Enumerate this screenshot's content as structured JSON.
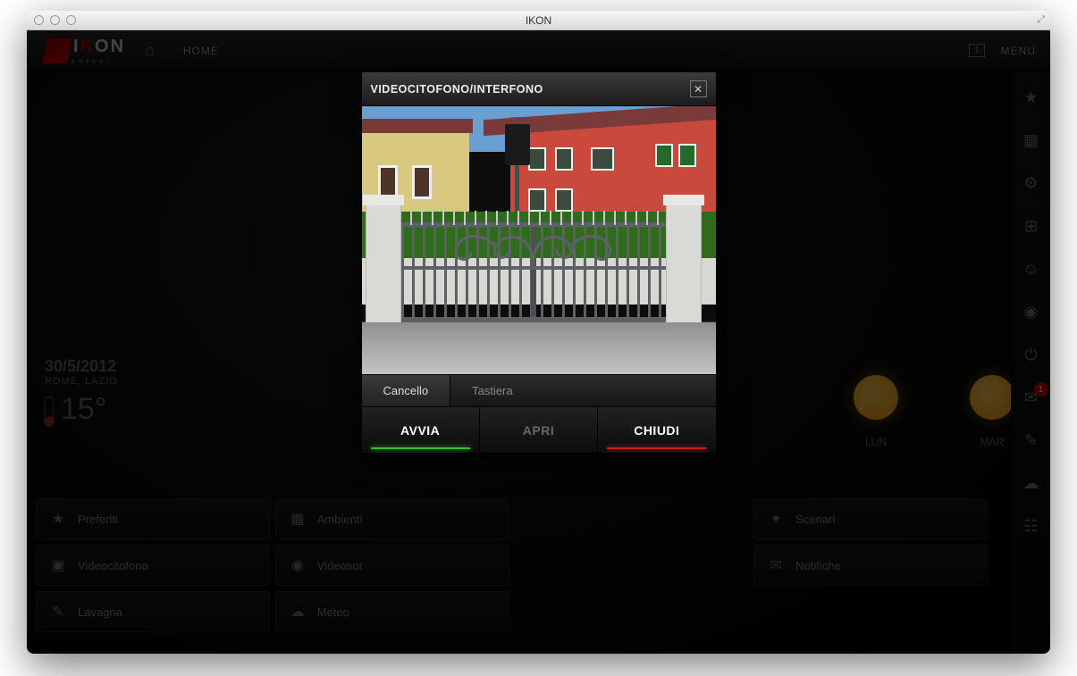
{
  "window": {
    "title": "IKON"
  },
  "logo": {
    "brand_a": "I",
    "brand_b": "ON",
    "sub": "server"
  },
  "topbar": {
    "home_tab": "HOME",
    "menu": "MENU"
  },
  "weather": {
    "date": "30/5/2012",
    "location": "ROME, LAZIO",
    "temp": "15°"
  },
  "forecast": [
    {
      "day": "LUN"
    },
    {
      "day": "MAR"
    }
  ],
  "quicklinks": [
    {
      "label": "Preferiti",
      "icon": "★"
    },
    {
      "label": "Ambienti",
      "icon": "▦"
    },
    {
      "label": "",
      "icon": ""
    },
    {
      "label": "Scenari",
      "icon": "✦"
    },
    {
      "label": "Videocitofono",
      "icon": "▣"
    },
    {
      "label": "Videosor",
      "icon": "◉"
    },
    {
      "label": "",
      "icon": ""
    },
    {
      "label": "Notifiche",
      "icon": "✉"
    },
    {
      "label": "Lavagna",
      "icon": "✎"
    },
    {
      "label": "Meteo",
      "icon": "☁"
    },
    {
      "label": "",
      "icon": ""
    },
    {
      "label": "",
      "icon": ""
    }
  ],
  "dock_badge": "1",
  "modal": {
    "title": "VIDEOCITOFONO/INTERFONO",
    "tabs": {
      "cancello": "Cancello",
      "tastiera": "Tastiera"
    },
    "actions": {
      "avvia": "AVVIA",
      "apri": "APRI",
      "chiudi": "CHIUDI"
    }
  }
}
